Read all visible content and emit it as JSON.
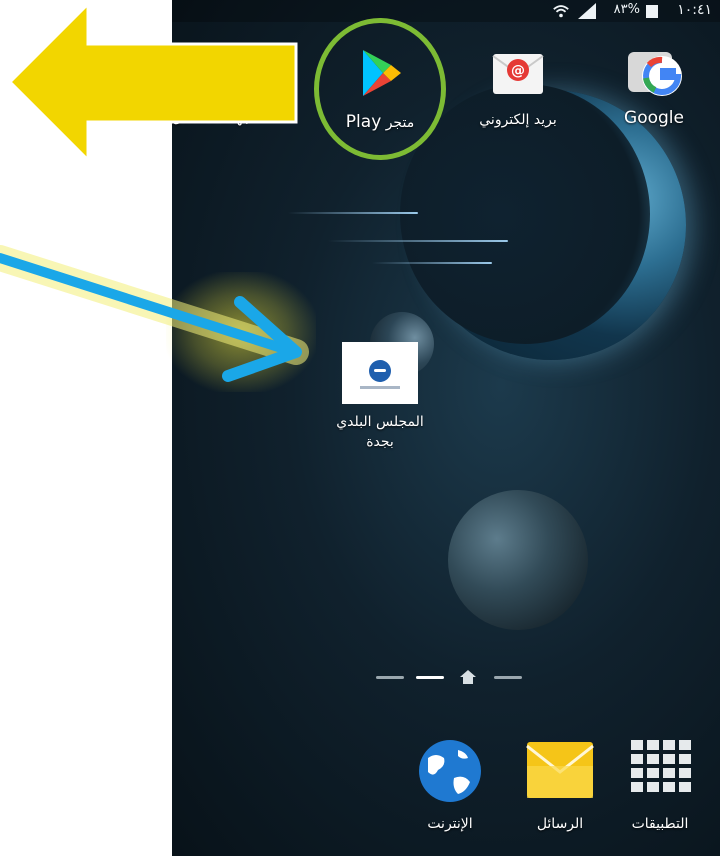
{
  "status_bar": {
    "time": "١٠:٤١",
    "battery": "٨٣%"
  },
  "apps_top": {
    "contacts_label": "جهات الاتصال",
    "play_label_ar": "متجر",
    "play_label_en": "Play",
    "email_label": "بريد إلكتروني",
    "google_label": "Google"
  },
  "shortcut": {
    "line1": "المجلس البلدي",
    "line2": "بجدة"
  },
  "dock": {
    "internet_label": "الإنترنت",
    "messages_label": "الرسائل",
    "apps_label": "التطبيقات"
  },
  "colors": {
    "arrow_yellow": "#f2d600",
    "arrow_blue": "#1aa7e8",
    "highlight_ring": "#7dbb34",
    "glow_yellow": "#efe65a"
  },
  "icons": {
    "wifi": "wifi-icon",
    "signal": "signal-icon",
    "battery": "battery-icon",
    "play": "play-store-icon",
    "email": "email-icon",
    "google": "google-icon",
    "home": "home-icon",
    "globe": "globe-icon",
    "messages": "envelope-icon",
    "apps": "apps-grid-icon"
  }
}
